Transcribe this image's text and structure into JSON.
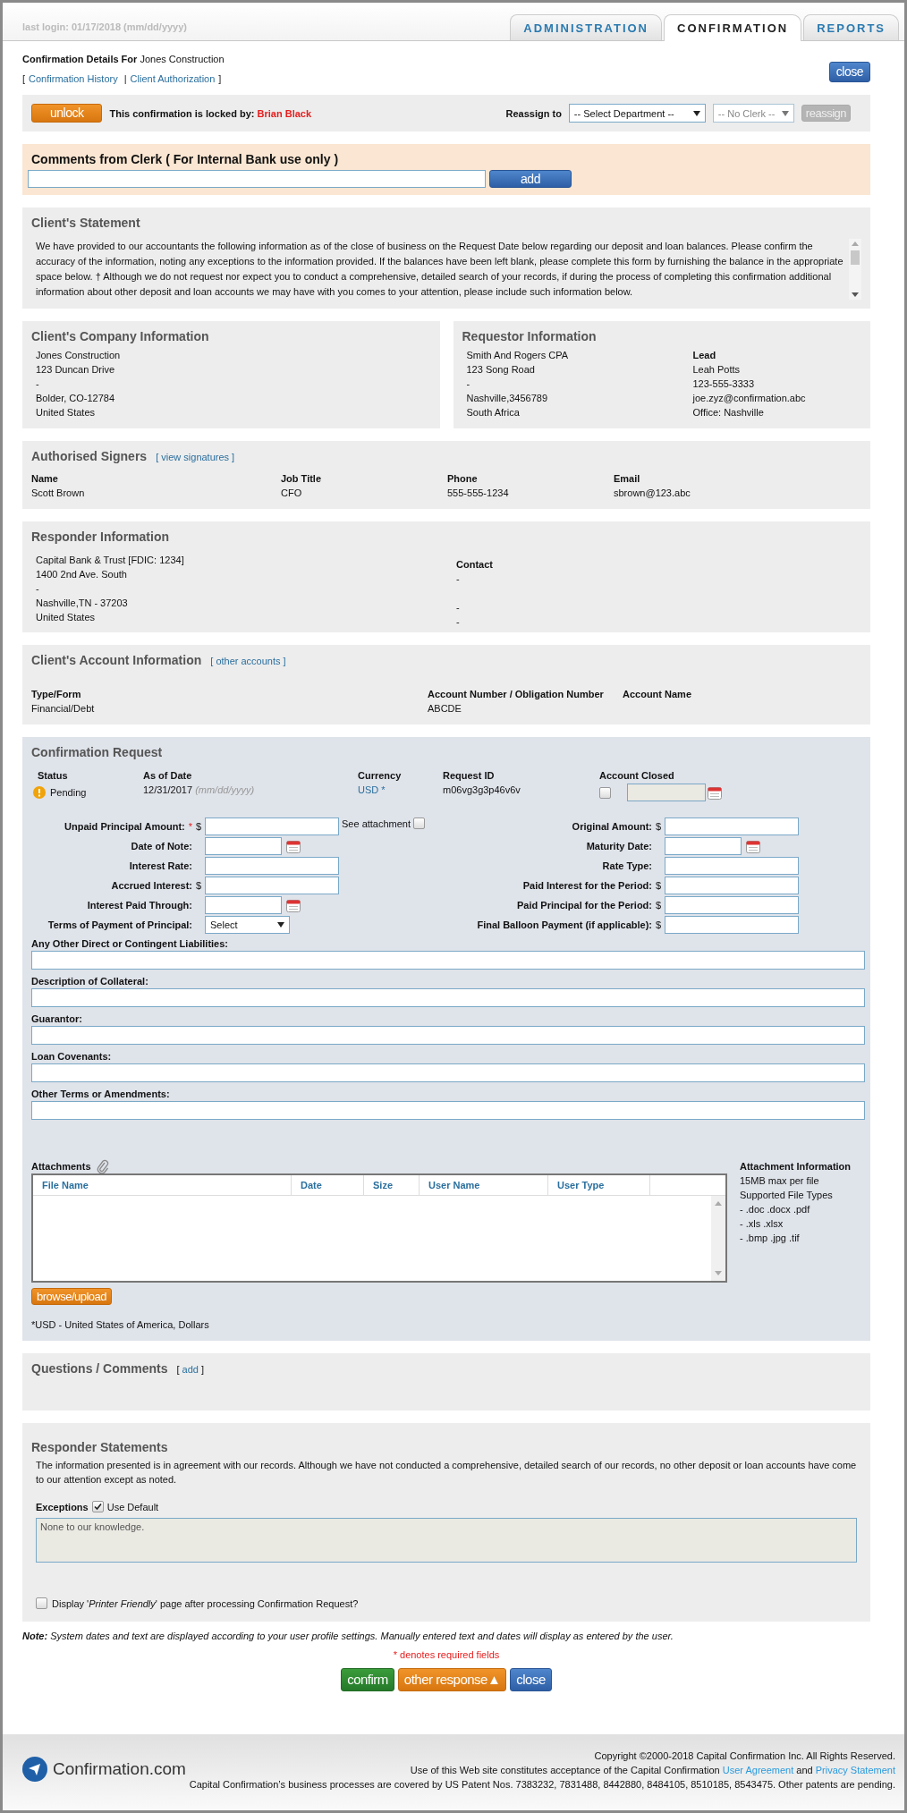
{
  "header": {
    "last_login": "last login: 01/17/2018 (mm/dd/yyyy)"
  },
  "tabs": [
    {
      "label": "ADMINISTRATION",
      "selected": false
    },
    {
      "label": "CONFIRMATION",
      "selected": true
    },
    {
      "label": "REPORTS",
      "selected": false
    }
  ],
  "title": {
    "label": "Confirmation Details For",
    "client": "Jones Construction"
  },
  "links_bar": {
    "open": "[",
    "items": [
      "Confirmation History",
      "Client Authorization"
    ],
    "separator": "|",
    "close": "]"
  },
  "close_button": "close",
  "lock_bar": {
    "unlock_button": "unlock",
    "locked_text": "This confirmation is locked by:",
    "locked_by": "Brian Black",
    "reassign_label": "Reassign to",
    "department_select": "-- Select Department --",
    "clerk_select": {
      "value": "-- No Clerk --",
      "disabled": true
    },
    "reassign_button": {
      "label": "reassign",
      "disabled": true
    }
  },
  "clerk_comments": {
    "title": "Comments from Clerk ( For Internal Bank use only )",
    "add_button": "add"
  },
  "client_statement": {
    "title": "Client's Statement",
    "text": "We have provided to our accountants the following information as of the close of business on the Request Date below regarding our deposit and loan balances. Please confirm the accuracy of the information, noting any exceptions to the information provided. If the balances have been left blank, please complete this form by furnishing the balance in the appropriate space below. † Although we do not request nor expect you to conduct a comprehensive, detailed search of your records, if during the process of completing this confirmation additional information about other deposit and loan accounts we may have with you comes to your attention, please include such information below."
  },
  "company_info": {
    "title": "Client's Company Information",
    "lines": [
      "Jones Construction",
      "123 Duncan Drive",
      "-",
      "Bolder, CO-12784",
      "United States"
    ]
  },
  "requestor_info": {
    "title": "Requestor Information",
    "lines": [
      "Smith And Rogers CPA",
      "123 Song Road",
      "-",
      "Nashville,3456789",
      "South Africa"
    ],
    "lead_label": "Lead",
    "lead_lines": [
      "Leah Potts",
      "123-555-3333",
      "joe.zyz@confirmation.abc",
      "Office: Nashville"
    ]
  },
  "signers": {
    "title": "Authorised Signers",
    "link": "[ view signatures ]",
    "columns": [
      "Name",
      "Job Title",
      "Phone",
      "Email"
    ],
    "rows": [
      [
        "Scott Brown",
        "CFO",
        "555-555-1234",
        "sbrown@123.abc"
      ]
    ]
  },
  "responder_info": {
    "title": "Responder Information",
    "lines": [
      "Capital Bank & Trust [FDIC: 1234]",
      "1400 2nd Ave. South",
      "-",
      "Nashville,TN - 37203",
      "United States"
    ],
    "contact_label": "Contact",
    "contact_lines": [
      "-",
      "-",
      "-"
    ]
  },
  "account_info": {
    "title": "Client's Account Information",
    "link": "[ other accounts ]",
    "columns": [
      "Type/Form",
      "Account Number / Obligation Number",
      "Account Name"
    ],
    "row": [
      "Financial/Debt",
      "ABCDE"
    ]
  },
  "confirmation_request": {
    "title": "Confirmation Request",
    "summary": {
      "status_label": "Status",
      "status": "Pending",
      "as_of_label": "As of Date",
      "as_of": "12/31/2017",
      "as_of_hint": "(mm/dd/yyyy)",
      "currency_label": "Currency",
      "currency": "USD *",
      "request_id_label": "Request ID",
      "request_id": "m06vg3g3p46v6v",
      "account_closed_label": "Account Closed",
      "account_closed": false
    },
    "see_attachment": {
      "label": "See attachment",
      "checked": false
    },
    "rows": [
      {
        "left": {
          "label": "Unpaid Principal Amount:",
          "marker": "*",
          "prefix": "$",
          "kind": "text"
        },
        "right": {
          "label": "Original Amount:",
          "prefix": "$",
          "kind": "text"
        }
      },
      {
        "left": {
          "label": "Date of Note:",
          "kind": "date"
        },
        "right": {
          "label": "Maturity Date:",
          "kind": "date"
        }
      },
      {
        "left": {
          "label": "Interest Rate:",
          "kind": "text"
        },
        "right": {
          "label": "Rate Type:",
          "kind": "text"
        }
      },
      {
        "left": {
          "label": "Accrued Interest:",
          "prefix": "$",
          "kind": "text"
        },
        "right": {
          "label": "Paid Interest for the Period:",
          "prefix": "$",
          "kind": "text"
        }
      },
      {
        "left": {
          "label": "Interest Paid Through:",
          "kind": "date"
        },
        "right": {
          "label": "Paid Principal for the Period:",
          "prefix": "$",
          "kind": "text"
        }
      },
      {
        "left": {
          "label": "Terms of Payment of Principal:",
          "kind": "select",
          "value": "Select"
        },
        "right": {
          "label": "Final Balloon Payment (if applicable):",
          "prefix": "$",
          "kind": "text"
        }
      }
    ],
    "wide_fields": [
      "Any Other Direct or Contingent Liabilities:",
      "Description of Collateral:",
      "Guarantor:",
      "Loan Covenants:",
      "Other Terms or Amendments:"
    ],
    "attachments": {
      "label": "Attachments",
      "columns": [
        "File Name",
        "Date",
        "Size",
        "User Name",
        "User Type"
      ],
      "upload_button": "browse/upload",
      "info_title": "Attachment Information",
      "info_lines": [
        "15MB max per file",
        "Supported File Types",
        "- .doc .docx .pdf",
        "- .xls .xlsx",
        "- .bmp .jpg .tif"
      ]
    },
    "footnote": "*USD - United States of America, Dollars"
  },
  "questions": {
    "title": "Questions / Comments",
    "open": "[",
    "link": "add",
    "close": "]"
  },
  "responder_statements": {
    "title": "Responder Statements",
    "text": "The information presented is in agreement with our records. Although we have not conducted a comprehensive, detailed search of our records, no other deposit or loan accounts have come to our attention except as noted.",
    "exceptions_label": "Exceptions",
    "use_default": {
      "label": "Use Default",
      "checked": true
    },
    "exceptions_value": "None to our knowledge.",
    "printer_friendly": {
      "label": "Display '*Printer Friendly*' page after processing Confirmation Request?",
      "checked": false
    }
  },
  "note": {
    "label": "Note:",
    "text": "System dates and text are displayed according to your user profile settings. Manually entered text and dates will display as entered by the user."
  },
  "required_note": "* denotes required fields",
  "actions": [
    {
      "label": "confirm",
      "kind": "confirm"
    },
    {
      "label": "other response▲",
      "kind": "other"
    },
    {
      "label": "close",
      "kind": "close"
    }
  ],
  "footer": {
    "brand": "Confirmation.com",
    "copyright": "Copyright ©2000-2018 Capital Confirmation Inc. All Rights Reserved.",
    "terms_prefix": "Use of this Web site constitutes acceptance of the Capital Confirmation",
    "links": [
      "User Agreement",
      "Privacy Statement"
    ],
    "and": "and",
    "patents": "Capital Confirmation’s business processes are covered by US Patent Nos. 7383232, 7831488, 8442880, 8484105, 8510185, 8543475. Other patents are pending."
  }
}
